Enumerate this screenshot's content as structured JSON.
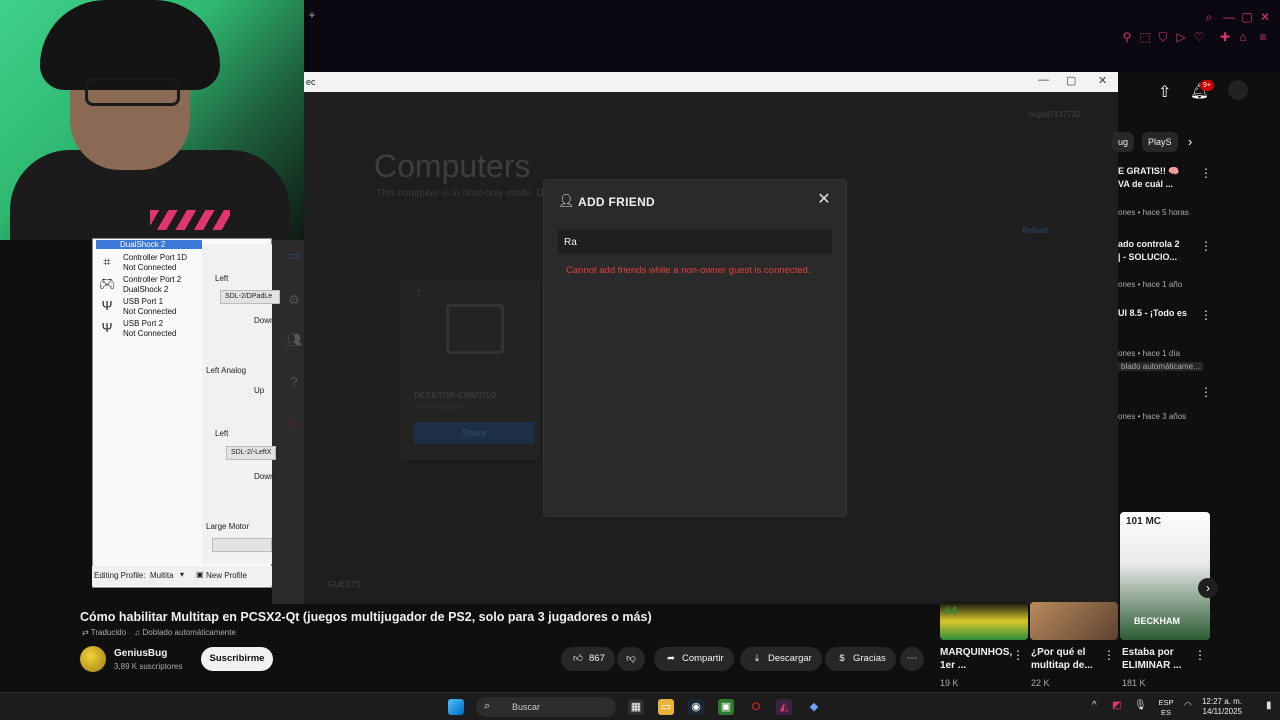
{
  "webcam": {},
  "controller_panel": {
    "selected_label": "DualShock 2",
    "items": [
      {
        "icon": "grid-icon",
        "line1": "Controller Port 1D",
        "line2": "Not Connected"
      },
      {
        "icon": "gamepad-icon",
        "line1": "Controller Port 2",
        "line2": "DualShock 2"
      },
      {
        "icon": "usb-icon",
        "line1": "USB Port 1",
        "line2": "Not Connected"
      },
      {
        "icon": "usb-icon",
        "line1": "USB Port 2",
        "line2": "Not Connected"
      }
    ],
    "bindings": {
      "left_label": "Left",
      "left_value": "SDL-2/DPadLe",
      "down_label": "Down",
      "left_analog_label": "Left Analog",
      "up_label": "Up",
      "left2_label": "Left",
      "left2_value": "SDL-2/-LeftX",
      "down2_label": "Down",
      "large_motor_label": "Large Motor"
    },
    "profile": {
      "editing_label": "Editing Profile:",
      "profile_value": "Multita",
      "new_profile_label": "New Profile"
    }
  },
  "app": {
    "window_title": "ec",
    "page_title": "Computers",
    "page_subtitle": "This computer is in host-only mode. Dis",
    "user_tag": "vegati7137732",
    "reload_label": "Reload",
    "device_name": "DESKTOP-CMM7I1O",
    "device_sub": "This Computer",
    "device_count": "1",
    "share_label": "Share",
    "guests_label": "GUESTS"
  },
  "modal": {
    "title": "ADD FRIEND",
    "input_value": "Ra",
    "error": "Cannot add friends while a non-owner guest is connected."
  },
  "youtube": {
    "notif_badge": "9+",
    "chips": [
      "ug",
      "PlayS"
    ],
    "recs": [
      {
        "title": "E GRATIS!! 🧠",
        "title2": "VA de cuál ...",
        "meta": "ones • hace 5 horas"
      },
      {
        "title": "ado controla 2",
        "title2": "| - SOLUCIO...",
        "meta": "ones • hace 1 año"
      },
      {
        "title": "UI 8.5 - ¡Todo es",
        "title2": "",
        "meta": "ones • hace 1 día",
        "meta2": "blado automáticame..."
      },
      {
        "title": "",
        "title2": "",
        "meta": "ones • hace 3 años"
      }
    ],
    "video_title": "Cómo habilitar Multitap en PCSX2-Qt (juegos multijugador de PS2, solo para 3 jugadores o más)",
    "translated_label": "Traducido",
    "dubbed_label": "Doblado automáticamente",
    "channel_name": "GeniusBug",
    "subscribers": "3,89 K suscriptores",
    "subscribe_label": "Suscribirme",
    "likes": "867",
    "share_label": "Compartir",
    "download_label": "Descargar",
    "thanks_label": "Gracias",
    "shorts": [
      {
        "title": "MARQUINHOS, 1er ...",
        "views": "19 K"
      },
      {
        "title": "¿Por qué el multitap de...",
        "views": "22 K"
      },
      {
        "title": "Estaba por ELIMINAR ...",
        "views": "181 K"
      }
    ],
    "thumb_text_top": "101 MC",
    "thumb_text_bottom": "BECKHAM",
    "badge_number": "#4"
  },
  "taskbar": {
    "search_placeholder": "Buscar",
    "lang_line1": "ESP",
    "lang_line2": "ES",
    "time": "12:27 a. m.",
    "date": "14/11/2025"
  },
  "colors": {
    "error_red": "#e0413a",
    "brand_accent": "#d6336c",
    "webcam_green": "#3fd18a"
  }
}
